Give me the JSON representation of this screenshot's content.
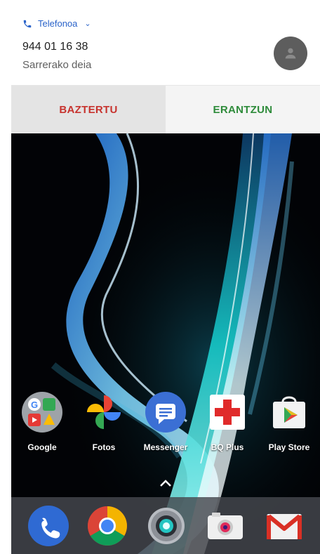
{
  "notification": {
    "app_name": "Telefonoa",
    "caller_number": "944 01 16 38",
    "call_type": "Sarrerako deia",
    "decline_label": "BAZTERTU",
    "answer_label": "ERANTZUN",
    "decline_color": "#c7332e",
    "answer_color": "#2e8b3a",
    "accent_color": "#2a63c9"
  },
  "home": {
    "apps": [
      {
        "label": "Google",
        "icon": "google-folder-icon"
      },
      {
        "label": "Fotos",
        "icon": "photos-pinwheel-icon"
      },
      {
        "label": "Messenger",
        "icon": "messenger-icon"
      },
      {
        "label": "BQ Plus",
        "icon": "bq-plus-icon"
      },
      {
        "label": "Play Store",
        "icon": "play-store-icon"
      }
    ],
    "dock": [
      {
        "icon": "phone-icon"
      },
      {
        "icon": "chrome-icon"
      },
      {
        "icon": "camera-icon"
      },
      {
        "icon": "bq-camera-icon"
      },
      {
        "icon": "gmail-icon"
      }
    ]
  }
}
